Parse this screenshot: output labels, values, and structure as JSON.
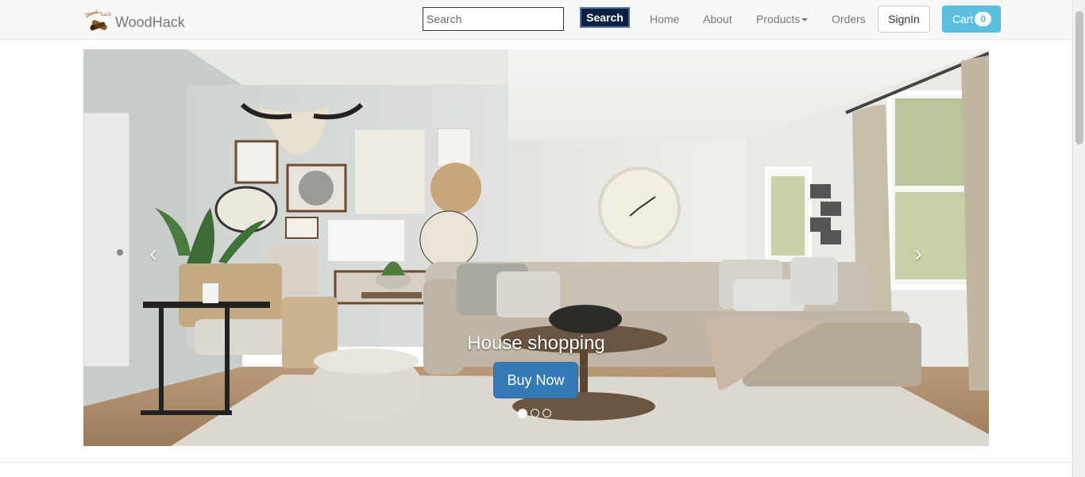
{
  "brand": {
    "name": "WoodHack",
    "logo_text": "Wood hack"
  },
  "search": {
    "placeholder": "Search",
    "button_label": "Search"
  },
  "nav": {
    "home": "Home",
    "about": "About",
    "products": "Products",
    "orders": "Orders",
    "signin": "SignIn",
    "cart": "Cart",
    "cart_count": "0"
  },
  "carousel": {
    "caption": "House shopping",
    "cta": "Buy Now",
    "slides": 3,
    "active_slide": 1
  },
  "colors": {
    "search_button": "#0a1f44",
    "cta": "#337ab7",
    "cart": "#5bc0de"
  }
}
